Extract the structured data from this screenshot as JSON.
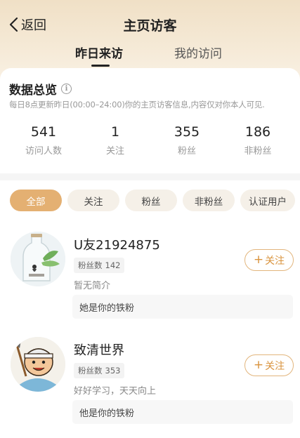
{
  "nav": {
    "back_label": "返回",
    "title": "主页访客"
  },
  "tabs": [
    {
      "label": "昨日来访",
      "active": true
    },
    {
      "label": "我的访问",
      "active": false
    }
  ],
  "overview": {
    "title": "数据总览",
    "description": "每日8点更新昨日(00:00–24:00)你的主页访客信息,内容仅对你本人可见.",
    "stats": [
      {
        "value": "541",
        "label": "访问人数"
      },
      {
        "value": "1",
        "label": "关注"
      },
      {
        "value": "355",
        "label": "粉丝"
      },
      {
        "value": "186",
        "label": "非粉丝"
      }
    ]
  },
  "filters": [
    {
      "label": "全部",
      "active": true
    },
    {
      "label": "关注",
      "active": false
    },
    {
      "label": "粉丝",
      "active": false
    },
    {
      "label": "非粉丝",
      "active": false
    },
    {
      "label": "认证用户",
      "active": false
    }
  ],
  "visitors": [
    {
      "name": "U友21924875",
      "fans_label": "粉丝数",
      "fans_count": "142",
      "bio": "暂无简介",
      "relation": "她是你的铁粉",
      "follow_label": "关注",
      "avatar_icon": "girl-in-bottle-avatar"
    },
    {
      "name": "致清世界",
      "fans_label": "粉丝数",
      "fans_count": "353",
      "bio": "好好学习，天天向上",
      "relation": "他是你的铁粉",
      "follow_label": "关注",
      "avatar_icon": "cartoon-boy-shovel-avatar"
    }
  ],
  "colors": {
    "accent": "#e4b072",
    "follow_text": "#d9933d",
    "header_bg": "#f0e0c6"
  }
}
